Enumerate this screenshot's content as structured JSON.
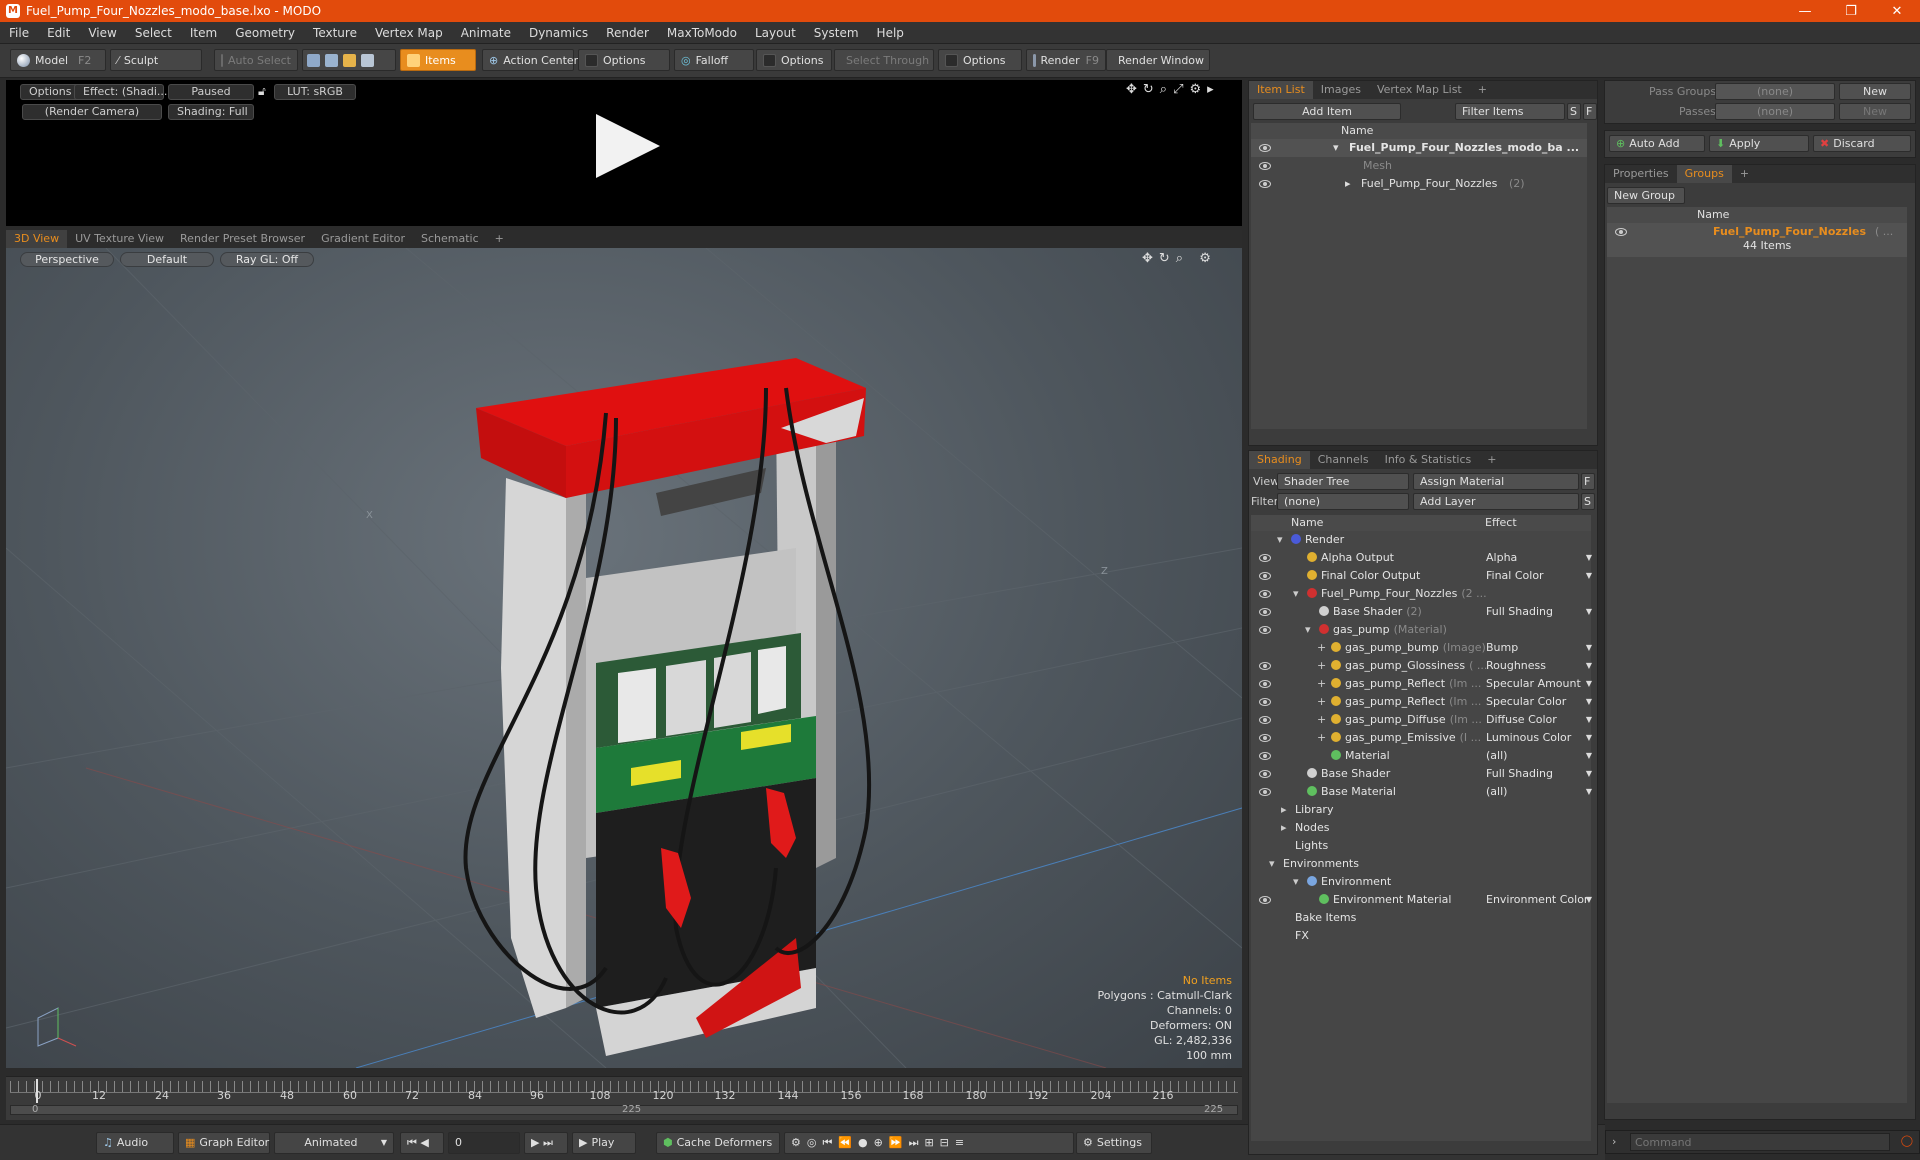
{
  "window": {
    "title": "Fuel_Pump_Four_Nozzles_modo_base.lxo - MODO",
    "minimize": "—",
    "restore": "❐",
    "close": "✕"
  },
  "menu": [
    "File",
    "Edit",
    "View",
    "Select",
    "Item",
    "Geometry",
    "Texture",
    "Vertex Map",
    "Animate",
    "Dynamics",
    "Render",
    "MaxToModo",
    "Layout",
    "System",
    "Help"
  ],
  "toolbar": {
    "model": "Model",
    "model_key": "F2",
    "sculpt": "Sculpt",
    "auto_select": "Auto Select",
    "items": "Items",
    "action_center": "Action Center",
    "options1": "Options",
    "falloff": "Falloff",
    "options2": "Options",
    "select_through": "Select Through",
    "options3": "Options",
    "render": "Render",
    "render_key": "F9",
    "render_window": "Render Window"
  },
  "preview": {
    "options": "Options",
    "effect": "Effect: (Shadi...",
    "paused": "Paused",
    "lut": "LUT: sRGB",
    "camera": "(Render Camera)",
    "shading": "Shading: Full"
  },
  "view_tabs": [
    "3D View",
    "UV Texture View",
    "Render Preset Browser",
    "Gradient Editor",
    "Schematic",
    "+"
  ],
  "viewport": {
    "perspective": "Perspective",
    "default": "Default",
    "raygl": "Ray GL: Off",
    "axis_x": "X",
    "axis_z": "Z",
    "stats": {
      "no_items": "No Items",
      "polygons": "Polygons : Catmull-Clark",
      "channels": "Channels: 0",
      "deformers": "Deformers: ON",
      "gl": "GL: 2,482,336",
      "scale": "100 mm"
    }
  },
  "timeline": {
    "ticks": [
      "0",
      "12",
      "24",
      "36",
      "48",
      "60",
      "72",
      "84",
      "96",
      "108",
      "120",
      "132",
      "144",
      "156",
      "168",
      "180",
      "192",
      "204",
      "216"
    ],
    "start": "0",
    "mid": "225",
    "end": "225"
  },
  "bottom": {
    "audio": "Audio",
    "graph_editor": "Graph Editor",
    "animated": "Animated",
    "frame": "0",
    "play": "Play",
    "cache": "Cache Deformers",
    "settings": "Settings",
    "command_placeholder": "Command"
  },
  "item_list": {
    "tabs": [
      "Item List",
      "Images",
      "Vertex Map List",
      "+"
    ],
    "add_item": "Add Item",
    "filter_items": "Filter Items",
    "s": "S",
    "f": "F",
    "col_name": "Name",
    "rows": [
      {
        "label": "Fuel_Pump_Four_Nozzles_modo_ba ...",
        "hint": ""
      },
      {
        "label": "Mesh",
        "hint": ""
      },
      {
        "label": "Fuel_Pump_Four_Nozzles",
        "hint": "(2)"
      }
    ]
  },
  "shading": {
    "tabs": [
      "Shading",
      "Channels",
      "Info & Statistics",
      "+"
    ],
    "view_label": "View",
    "view_value": "Shader Tree",
    "assign_material": "Assign Material",
    "f": "F",
    "filter_label": "Filter",
    "filter_value": "(none)",
    "add_layer": "Add Layer",
    "s": "S",
    "col_name": "Name",
    "col_effect": "Effect",
    "rows": [
      {
        "label": "Render",
        "hint": "",
        "effect": ""
      },
      {
        "label": "Alpha Output",
        "hint": "",
        "effect": "Alpha"
      },
      {
        "label": "Final Color Output",
        "hint": "",
        "effect": "Final Color"
      },
      {
        "label": "Fuel_Pump_Four_Nozzles",
        "hint": "(2 ...",
        "effect": ""
      },
      {
        "label": "Base Shader",
        "hint": "(2)",
        "effect": "Full Shading"
      },
      {
        "label": "gas_pump",
        "hint": "(Material)",
        "effect": ""
      },
      {
        "label": "gas_pump_bump",
        "hint": "(Image)",
        "effect": "Bump"
      },
      {
        "label": "gas_pump_Glossiness",
        "hint": "( ...",
        "effect": "Roughness"
      },
      {
        "label": "gas_pump_Reflect",
        "hint": "(Im ...",
        "effect": "Specular Amount"
      },
      {
        "label": "gas_pump_Reflect",
        "hint": "(Im ...",
        "effect": "Specular Color"
      },
      {
        "label": "gas_pump_Diffuse",
        "hint": "(Im ...",
        "effect": "Diffuse Color"
      },
      {
        "label": "gas_pump_Emissive",
        "hint": "(I ...",
        "effect": "Luminous Color"
      },
      {
        "label": "Material",
        "hint": "",
        "effect": "(all)"
      },
      {
        "label": "Base Shader",
        "hint": "",
        "effect": "Full Shading"
      },
      {
        "label": "Base Material",
        "hint": "",
        "effect": "(all)"
      },
      {
        "label": "Library",
        "hint": "",
        "effect": ""
      },
      {
        "label": "Nodes",
        "hint": "",
        "effect": ""
      },
      {
        "label": "Lights",
        "hint": "",
        "effect": ""
      },
      {
        "label": "Environments",
        "hint": "",
        "effect": ""
      },
      {
        "label": "Environment",
        "hint": "",
        "effect": ""
      },
      {
        "label": "Environment Material",
        "hint": "",
        "effect": "Environment Color"
      },
      {
        "label": "Bake Items",
        "hint": "",
        "effect": ""
      },
      {
        "label": "FX",
        "hint": "",
        "effect": ""
      }
    ]
  },
  "groups": {
    "pass_groups": "Pass Groups",
    "passes": "Passes",
    "none": "(none)",
    "new": "New",
    "auto_add": "Auto Add",
    "apply": "Apply",
    "discard": "Discard",
    "tabs": [
      "Properties",
      "Groups",
      "+"
    ],
    "new_group": "New Group",
    "col_name": "Name",
    "group_name": "Fuel_Pump_Four_Nozzles",
    "group_hint": "( ...",
    "group_count": "44 Items"
  },
  "colors": {
    "accent": "#e88d1e",
    "titlebar": "#e24b0c",
    "pump_red": "#e01010",
    "pump_green": "#1e7a3a"
  }
}
